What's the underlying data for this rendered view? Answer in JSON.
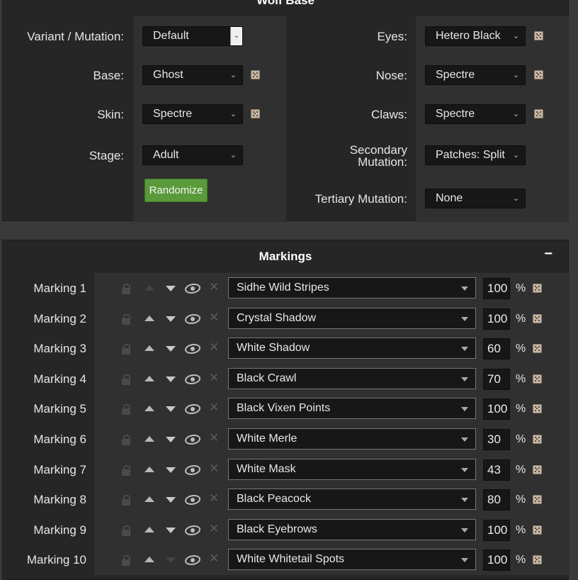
{
  "base_panel": {
    "title": "Wolf Base",
    "variant": {
      "label": "Variant / Mutation:",
      "value": "Default"
    },
    "base": {
      "label": "Base:",
      "value": "Ghost"
    },
    "skin": {
      "label": "Skin:",
      "value": "Spectre"
    },
    "stage": {
      "label": "Stage:",
      "value": "Adult"
    },
    "eyes": {
      "label": "Eyes:",
      "value": "Hetero Black"
    },
    "nose": {
      "label": "Nose:",
      "value": "Spectre"
    },
    "claws": {
      "label": "Claws:",
      "value": "Spectre"
    },
    "secondary": {
      "label_line1": "Secondary",
      "label_line2": "Mutation:",
      "value": "Patches: Split"
    },
    "tertiary": {
      "label": "Tertiary Mutation:",
      "value": "None"
    },
    "randomize_label": "Randomize"
  },
  "markings_panel": {
    "title": "Markings",
    "collapse_symbol": "−",
    "percent_symbol": "%",
    "rows": [
      {
        "label": "Marking 1",
        "value": "Sidhe Wild Stripes",
        "percent": "100"
      },
      {
        "label": "Marking 2",
        "value": "Crystal Shadow",
        "percent": "100"
      },
      {
        "label": "Marking 3",
        "value": "White Shadow",
        "percent": "60"
      },
      {
        "label": "Marking 4",
        "value": "Black Crawl",
        "percent": "70"
      },
      {
        "label": "Marking 5",
        "value": "Black Vixen Points",
        "percent": "100"
      },
      {
        "label": "Marking 6",
        "value": "White Merle",
        "percent": "30"
      },
      {
        "label": "Marking 7",
        "value": "White Mask",
        "percent": "43"
      },
      {
        "label": "Marking 8",
        "value": "Black Peacock",
        "percent": "80"
      },
      {
        "label": "Marking 9",
        "value": "Black Eyebrows",
        "percent": "100"
      },
      {
        "label": "Marking 10",
        "value": "White Whitetail Spots",
        "percent": "100"
      }
    ]
  },
  "colors": {
    "randomize_button": "#5a9a3a",
    "panel_bg": "#262626",
    "page_bg": "#3a3a3a"
  }
}
